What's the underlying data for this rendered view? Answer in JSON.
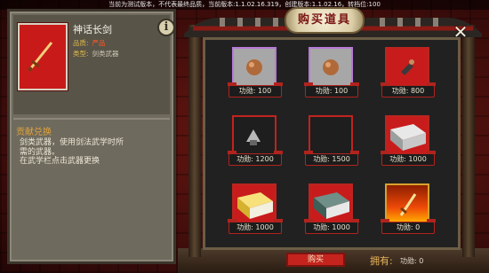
{
  "topbar": {
    "text": "当前为测试版本，不代表最终品质，当前版本:1.1.02.16.319，创建版本:1.1.02.16，转档位:100"
  },
  "detail": {
    "item_name": "神话长剑",
    "quality_label": "品质:",
    "quality_value": "严品",
    "type_label": "类型:",
    "type_value": "剑类武器",
    "info_icon": "info-icon",
    "section_title": "贡献兑换",
    "desc_lines": [
      "剑类武器，使用剑法武学时所",
      "需的武器。",
      "在武学栏点击武器更换"
    ]
  },
  "shop": {
    "title": "购买道具",
    "close_icon": "close-x-icon",
    "items": [
      {
        "icon": "round-bead-icon",
        "frame": "purple",
        "price": "功勋: 100"
      },
      {
        "icon": "round-bead-icon",
        "frame": "purple",
        "price": "功勋: 100"
      },
      {
        "icon": "hidden-weapon-icon",
        "frame": "red",
        "price": "功勋: 800"
      },
      {
        "icon": "claw-weapon-icon",
        "frame": "redhollow",
        "price": "功勋: 1200"
      },
      {
        "icon": "empty-slot",
        "frame": "redhollow",
        "price": "功勋: 1500"
      },
      {
        "icon": "grey-book-icon",
        "frame": "red",
        "price": "功勋: 1000"
      },
      {
        "icon": "yellow-book-icon",
        "frame": "red",
        "price": "功勋: 1000"
      },
      {
        "icon": "teal-book-icon",
        "frame": "red",
        "price": "功勋: 1000"
      },
      {
        "icon": "sword-icon",
        "frame": "gold",
        "price": "功勋: 0"
      }
    ],
    "buy_label": "购买",
    "own_label": "拥有:",
    "own_value": "功勋: 0"
  },
  "colors": {
    "accent_red": "#c81c1c",
    "purple_frame": "#b67ad6",
    "gold_frame": "#d6a22c",
    "label_gold": "#e1a33a"
  }
}
